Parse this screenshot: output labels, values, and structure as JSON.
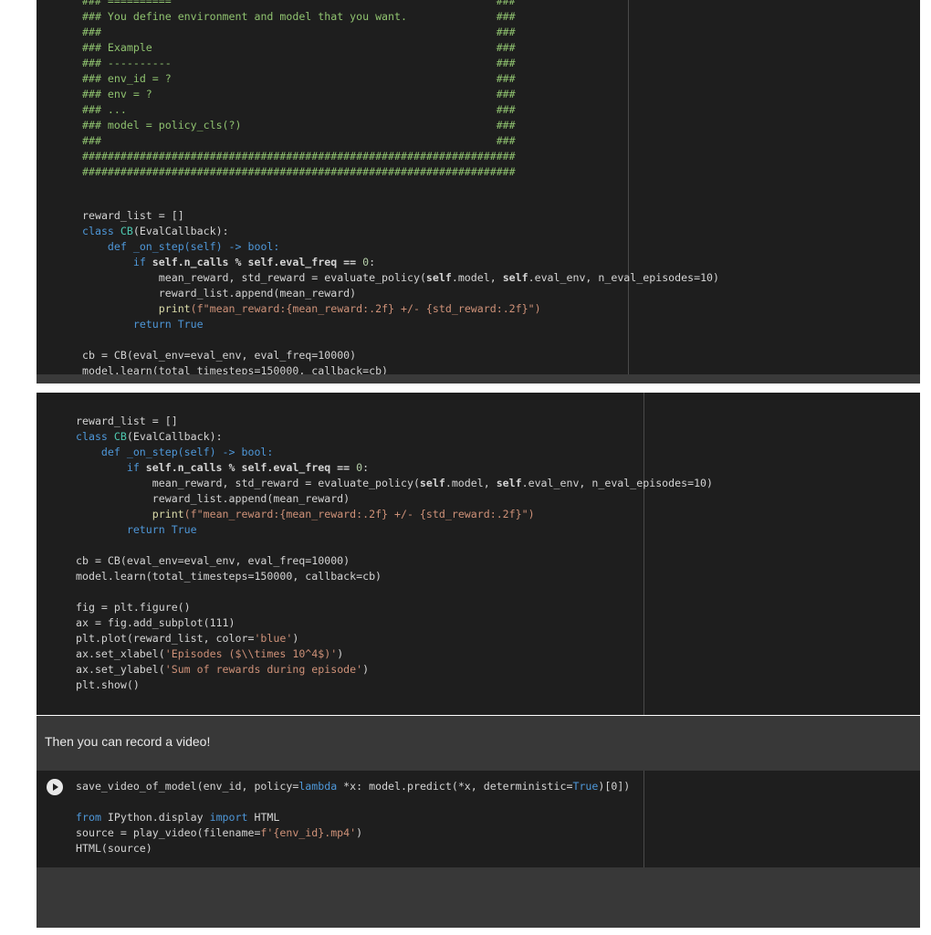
{
  "cell1": {
    "comment_lines": [
      "### ==========                                                   ###",
      "### You define environment and model that you want.              ###",
      "###                                                              ###",
      "### Example                                                      ###",
      "### ----------                                                   ###",
      "### env_id = ?                                                   ###",
      "### env = ?                                                      ###",
      "### ...                                                          ###",
      "### model = policy_cls(?)                                        ###",
      "###                                                              ###",
      "####################################################################",
      "####################################################################"
    ]
  },
  "code": {
    "reward_list": "reward_list = []",
    "class_kw": "class ",
    "class_name": "CB",
    "class_parent": "(EvalCallback):",
    "def_line": "    def _on_step(self) -> bool:",
    "if_kw": "        if ",
    "if_cond": "self.n_calls % self.eval_freq == ",
    "zero": "0",
    "colon": ":",
    "eval_a": "            mean_reward, std_reward = evaluate_policy(",
    "self_a": "self",
    "eval_b": ".model, ",
    "self_b": "self",
    "eval_c": ".eval_env, n_eval_episodes=10)",
    "append": "            reward_list.append(mean_reward)",
    "print_fn": "            print",
    "print_str": "(f\"mean_reward:{mean_reward:.2f} +/- {std_reward:.2f}\")",
    "return_kw": "        return ",
    "true_kw": "True",
    "cb_line": "cb = CB(eval_env=eval_env, eval_freq=10000)",
    "learn_line": "model.learn(total_timesteps=150000, callback=cb)",
    "fig1": "fig = plt.figure()",
    "fig2": "ax = fig.add_subplot(111)",
    "fig3a": "plt.plot(reward_list, color=",
    "fig3b": "'blue'",
    "fig3c": ")",
    "fig4a": "ax.set_xlabel(",
    "fig4b": "'Episodes ($\\\\times 10^4$)'",
    "fig4c": ")",
    "fig5a": "ax.set_ylabel(",
    "fig5b": "'Sum of rewards during episode'",
    "fig5c": ")",
    "fig6": "plt.show()"
  },
  "text_cell": "Then you can record a video!",
  "cell3": {
    "l1a": "save_video_of_model(env_id, policy=",
    "l1b": "lambda",
    "l1c": " *x: model.predict(*x, deterministic=",
    "l1d": "True",
    "l1e": ")[0])",
    "l2a": "from",
    "l2b": " IPython.display ",
    "l2c": "import",
    "l2d": " HTML",
    "l3a": "source = play_video(filename=",
    "l3b": "f'{env_id}.mp4'",
    "l3c": ")",
    "l4": "HTML(source)"
  },
  "icons": {
    "run": "play-circle-icon"
  }
}
